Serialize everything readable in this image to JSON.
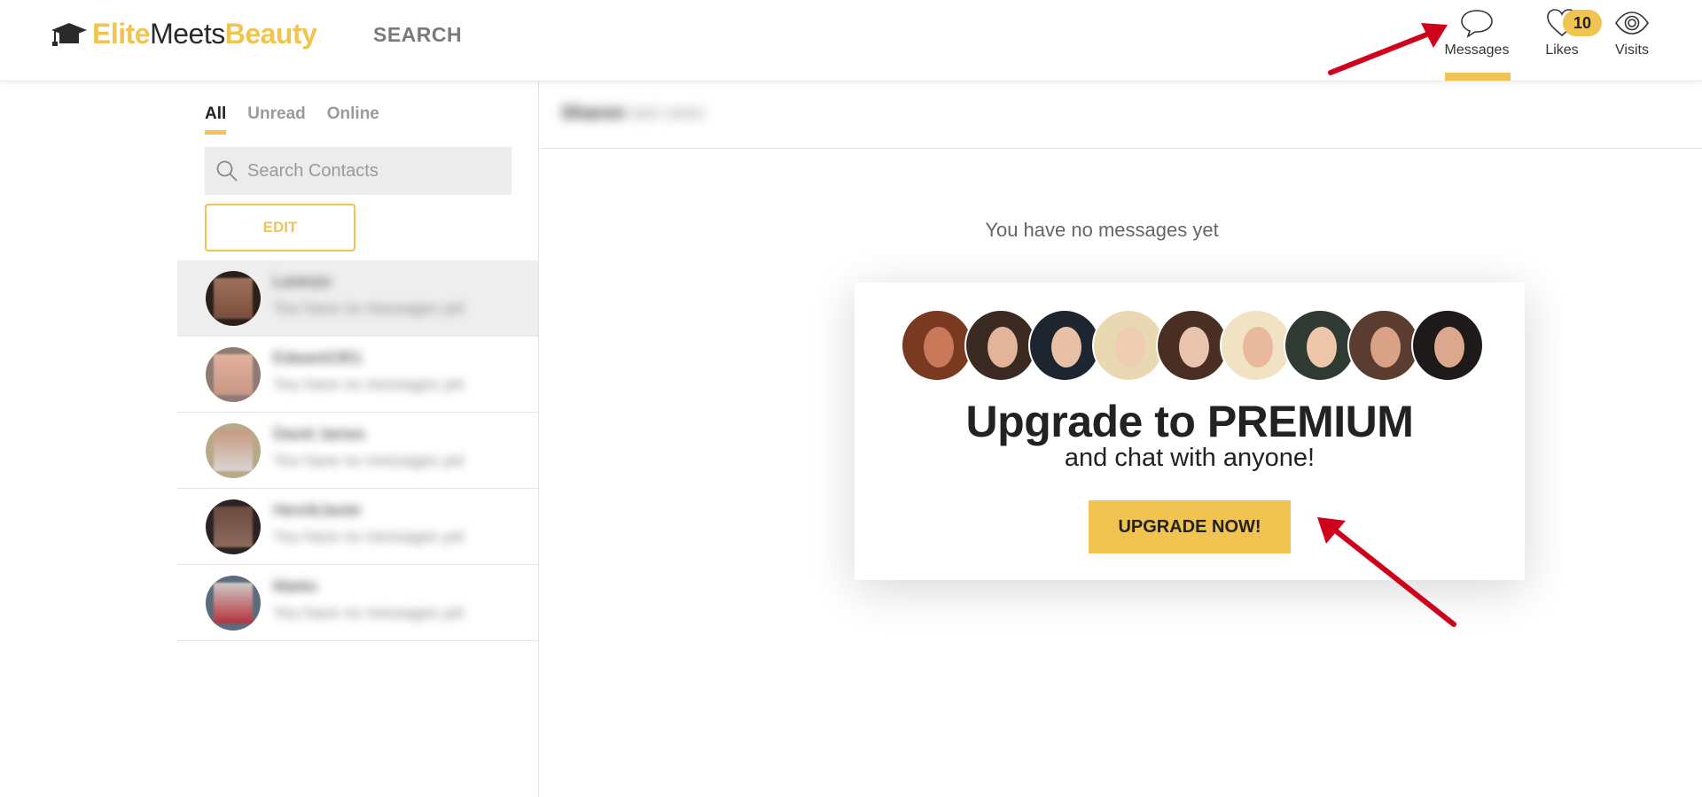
{
  "header": {
    "logo": {
      "elite": "Elite",
      "meets": "Meets",
      "beauty": "Beauty"
    },
    "nav_search": "SEARCH",
    "messages_label": "Messages",
    "likes_label": "Likes",
    "likes_count": "10",
    "visits_label": "Visits"
  },
  "sidebar": {
    "tabs": [
      {
        "label": "All",
        "active": true
      },
      {
        "label": "Unread",
        "active": false
      },
      {
        "label": "Online",
        "active": false
      }
    ],
    "search_placeholder": "Search Contacts",
    "edit_label": "EDIT",
    "contacts": [
      {
        "name": "Lorenzo",
        "preview": "You have no messages yet",
        "selected": true
      },
      {
        "name": "Edward1951",
        "preview": "You have no messages yet",
        "selected": false
      },
      {
        "name": "David James",
        "preview": "You have no messages yet",
        "selected": false
      },
      {
        "name": "HenrikJavier",
        "preview": "You have no messages yet",
        "selected": false
      },
      {
        "name": "Marko",
        "preview": "You have no messages yet",
        "selected": false
      }
    ]
  },
  "main": {
    "conversation_name": "Sharon",
    "conversation_status": "last seen",
    "empty_text": "You have no messages yet",
    "promo_title": "Upgrade to PREMIUM",
    "promo_subtitle": "and chat with anyone!",
    "upgrade_label": "UPGRADE NOW!"
  },
  "colors": {
    "accent": "#f1c350",
    "arrow": "#d0021b"
  }
}
